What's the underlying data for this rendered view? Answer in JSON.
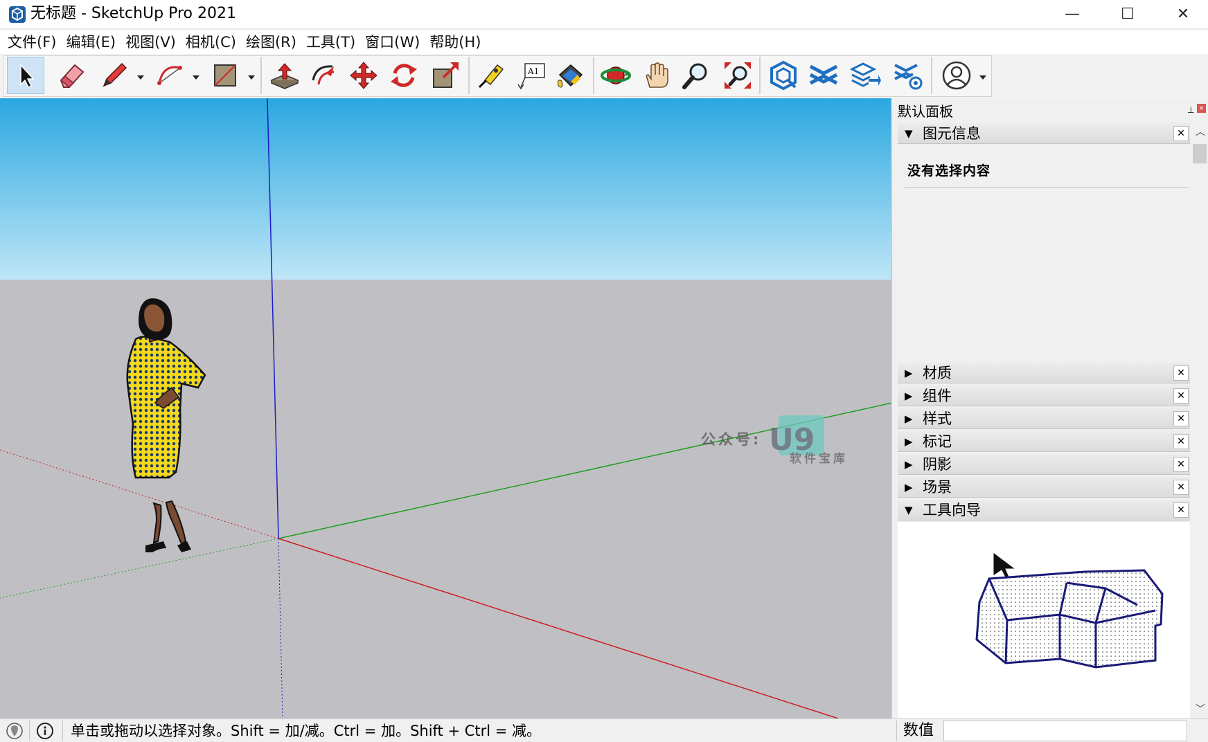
{
  "window": {
    "title": "无标题 - SketchUp Pro 2021",
    "minimize": "—",
    "maximize": "☐",
    "close": "✕"
  },
  "menu": [
    "文件(F)",
    "编辑(E)",
    "视图(V)",
    "相机(C)",
    "绘图(R)",
    "工具(T)",
    "窗口(W)",
    "帮助(H)"
  ],
  "toolbar": {
    "active_tool": "select-icon",
    "tools": [
      "select-icon",
      "eraser-icon",
      "pencil-line-icon",
      "arc-icon",
      "rectangle-icon",
      "push-pull-icon",
      "offset-icon",
      "move-icon",
      "rotate-icon",
      "scale-icon",
      "tape-measure-icon",
      "text-label-icon",
      "paint-bucket-icon",
      "orbit-icon",
      "pan-hand-icon",
      "zoom-icon",
      "zoom-extents-icon",
      "3d-warehouse-icon",
      "extension-warehouse-icon",
      "layout-send-icon",
      "extension-manager-icon",
      "account-icon"
    ]
  },
  "viewport": {
    "sky_color_top": "#2aa7e0",
    "sky_color_bottom": "#bfe6f7",
    "ground_color": "#c0c0c4",
    "axis_colors": {
      "red": "#cc1f1f",
      "green": "#1f9e1f",
      "blue": "#1c1cc8"
    },
    "watermark_prefix": "公众号:",
    "watermark_logo": "U9",
    "watermark_sub": "软件宝库"
  },
  "tray": {
    "title": "默认面板",
    "pin": "⊥",
    "close": "×",
    "entity_info": {
      "label": "图元信息",
      "expanded": true,
      "status": "没有选择内容"
    },
    "panels": [
      {
        "label": "材质",
        "expanded": false
      },
      {
        "label": "组件",
        "expanded": false
      },
      {
        "label": "样式",
        "expanded": false
      },
      {
        "label": "标记",
        "expanded": false
      },
      {
        "label": "阴影",
        "expanded": false
      },
      {
        "label": "场景",
        "expanded": false
      }
    ],
    "instructor": {
      "label": "工具向导",
      "expanded": true
    }
  },
  "statusbar": {
    "hint": "单击或拖动以选择对象。Shift = 加/减。Ctrl = 加。Shift + Ctrl = 减。",
    "measurements_label": "数值",
    "measurements_value": ""
  }
}
